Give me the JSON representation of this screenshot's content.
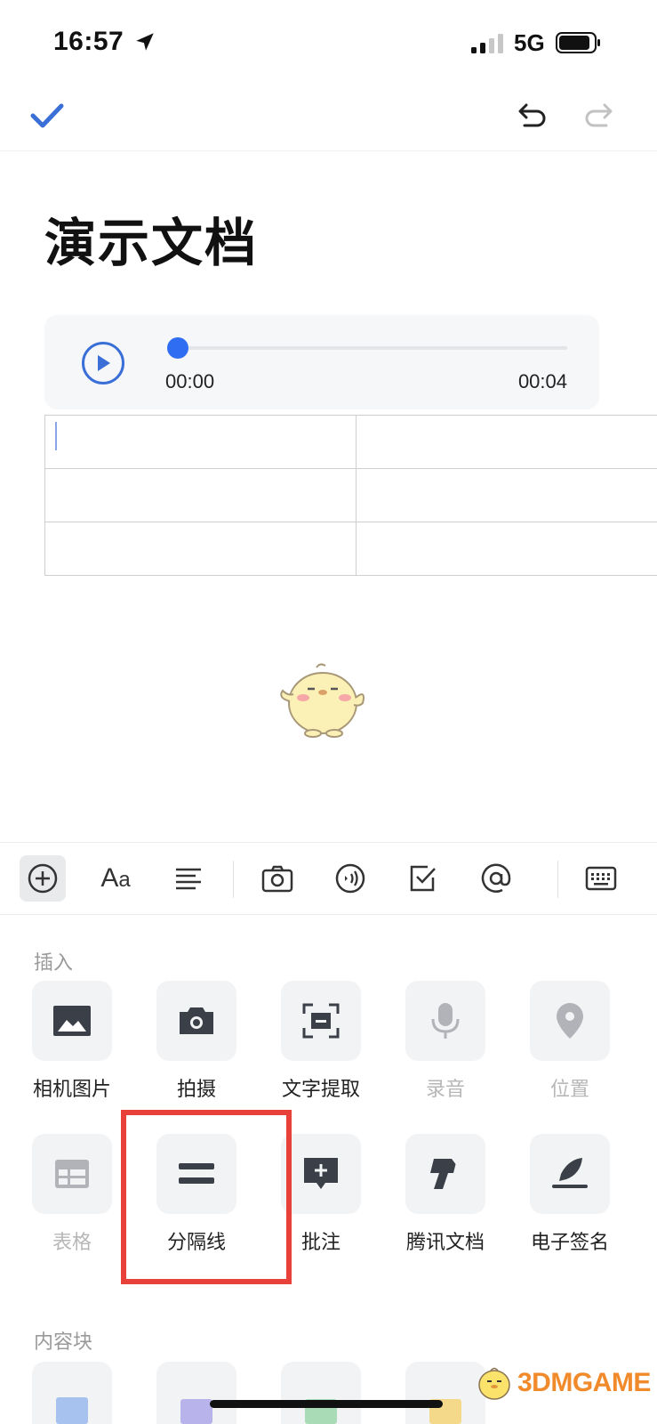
{
  "status_bar": {
    "time": "16:57",
    "network": "5G",
    "icons": [
      "location-arrow-icon",
      "signal-bars-icon",
      "battery-icon"
    ]
  },
  "top_bar": {
    "icons": [
      "checkmark-icon",
      "undo-icon",
      "redo-icon"
    ]
  },
  "document": {
    "title": "演示文档",
    "audio": {
      "current_time": "00:00",
      "duration": "00:04",
      "progress": 0
    },
    "table": {
      "rows": 3,
      "cols": 2
    }
  },
  "toolbar": {
    "font_icon_big": "A",
    "font_icon_small": "a",
    "items": [
      "plus-circle-icon",
      "font-format-icon",
      "align-icon",
      "camera-icon",
      "audio-icon",
      "checkbox-icon",
      "mention-icon",
      "keyboard-icon"
    ]
  },
  "insert_panel": {
    "section_label": "插入",
    "row1": [
      {
        "label": "相机图片",
        "icon": "image-icon",
        "disabled": false
      },
      {
        "label": "拍摄",
        "icon": "camera-icon",
        "disabled": false
      },
      {
        "label": "文字提取",
        "icon": "text-scan-icon",
        "disabled": false
      },
      {
        "label": "录音",
        "icon": "microphone-icon",
        "disabled": true
      },
      {
        "label": "位置",
        "icon": "location-pin-icon",
        "disabled": true
      }
    ],
    "row2": [
      {
        "label": "表格",
        "icon": "table-icon",
        "disabled": true
      },
      {
        "label": "分隔线",
        "icon": "divider-icon",
        "disabled": false
      },
      {
        "label": "批注",
        "icon": "comment-add-icon",
        "disabled": false
      },
      {
        "label": "腾讯文档",
        "icon": "tencent-docs-icon",
        "disabled": false
      },
      {
        "label": "电子签名",
        "icon": "signature-icon",
        "disabled": false
      }
    ],
    "section2_label": "内容块"
  },
  "watermark": {
    "text": "3DMGAME"
  },
  "colors": {
    "accent": "#2f6ef2",
    "highlight": "#e8413a",
    "tile_bg": "#f2f3f5",
    "icon_dark": "#3b3f48",
    "disabled": "#b7b7b7"
  }
}
